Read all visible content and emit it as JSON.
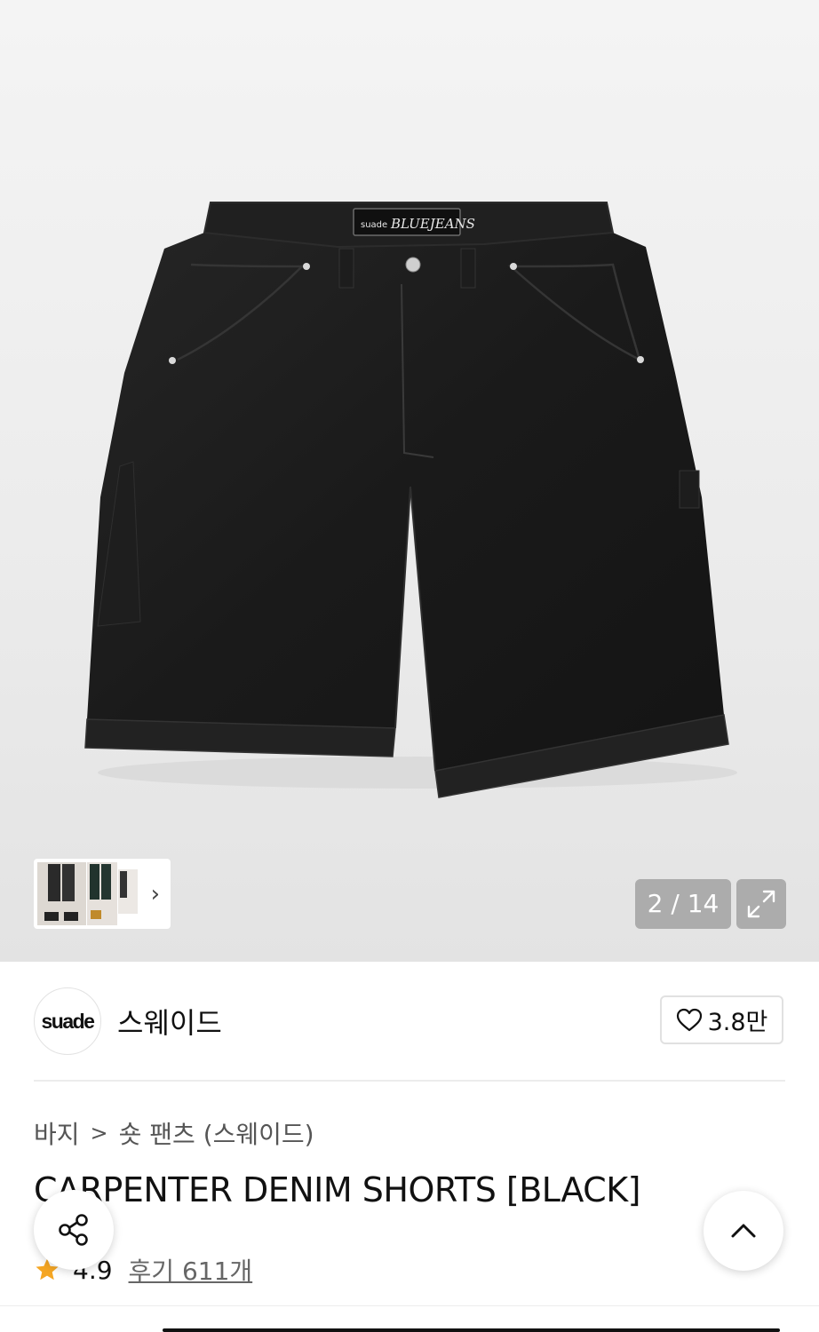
{
  "gallery": {
    "counter": "2 / 14",
    "expand_icon": "expand-icon",
    "thumbnail_next_icon": "chevron-right-icon"
  },
  "brand": {
    "logo_text": "suade",
    "name": "스웨이드",
    "likes": "3.8만",
    "like_icon": "heart-outline-icon"
  },
  "breadcrumb": {
    "category": "바지",
    "separator": ">",
    "subcategory": "숏 팬츠 (스웨이드)"
  },
  "product": {
    "title": "CARPENTER DENIM SHORTS [BLACK]",
    "rating": "4.9",
    "reviews": "후기 611개"
  },
  "floating": {
    "share_icon": "share-icon",
    "scroll_top_icon": "chevron-up-icon"
  },
  "colors": {
    "star": "#f5a623",
    "denim": "#1c1c1c"
  }
}
